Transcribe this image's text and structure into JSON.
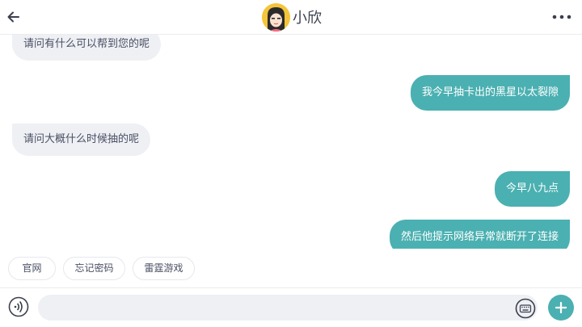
{
  "header": {
    "title": "小欣",
    "back_icon": "arrow-left-icon",
    "more_icon": "more-horizontal-icon"
  },
  "messages": [
    {
      "side": "left",
      "text": "请问有什么可以帮到您的呢"
    },
    {
      "side": "right",
      "text": "我今早抽卡出的黑星以太裂隙"
    },
    {
      "side": "left",
      "text": "请问大概什么时候抽的呢"
    },
    {
      "side": "right",
      "text": "今早八九点"
    },
    {
      "side": "right",
      "text": "然后他提示网络异常就断开了连接"
    }
  ],
  "quick_replies": [
    "官网",
    "忘记密码",
    "雷霆游戏"
  ],
  "input": {
    "value": "",
    "placeholder": "",
    "voice_icon": "voice-icon",
    "keyboard_icon": "keyboard-icon",
    "add_icon": "plus-icon"
  },
  "colors": {
    "accent": "#4bb0b1",
    "bubble_left": "#eef0f4",
    "text": "#4a4f63"
  }
}
